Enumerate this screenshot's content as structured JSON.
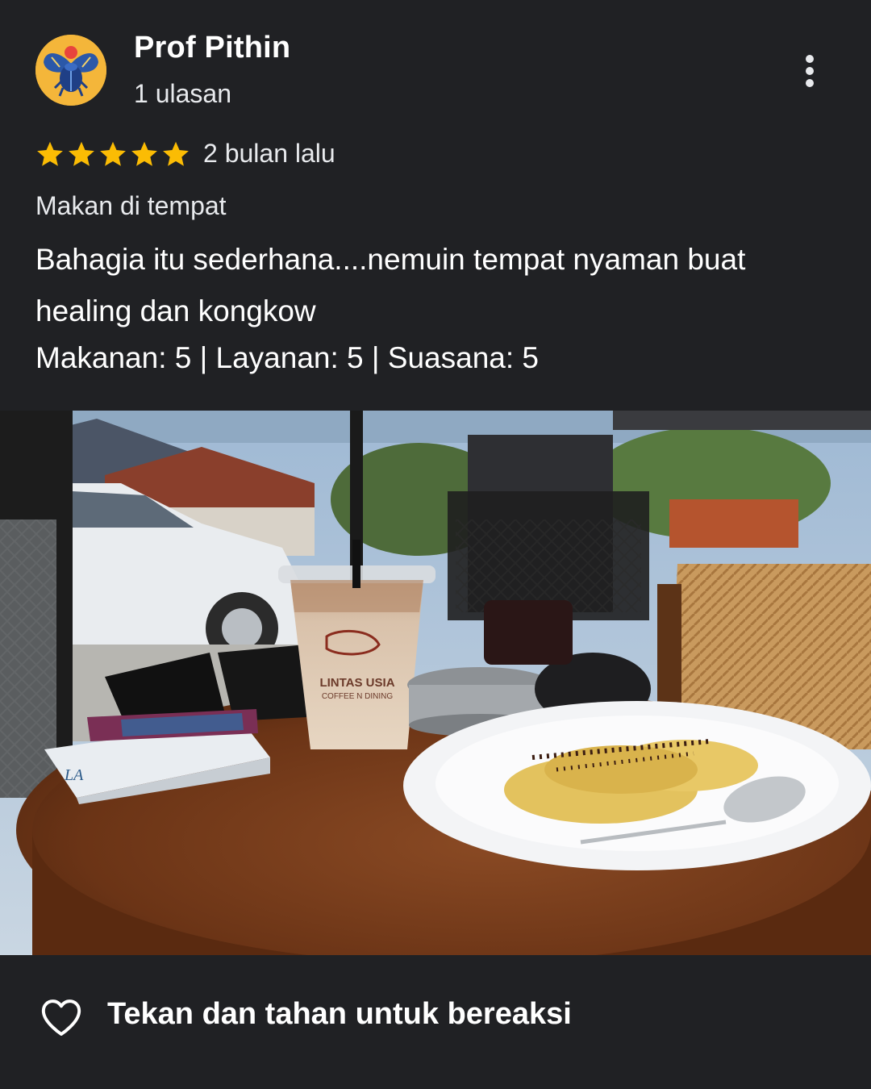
{
  "review": {
    "user_name": "Prof Pithin",
    "review_count": "1 ulasan",
    "avatar_icon": "scarab-beetle-avatar",
    "rating": 5,
    "max_rating": 5,
    "time": "2 bulan lalu",
    "dining_mode": "Makan di tempat",
    "text": "Bahagia itu sederhana....nemuin tempat nyaman buat healing dan kongkow",
    "sub_ratings": "Makanan: 5 | Layanan: 5 | Suasana: 5"
  },
  "photo": {
    "cup_brand": "LINTAS USIA",
    "cup_subtitle": "COFFEE N DINING",
    "pack_brand": "LA"
  },
  "reaction": {
    "label": "Tekan dan tahan untuk bereaksi",
    "icon": "heart-outline-icon"
  },
  "colors": {
    "background": "#202124",
    "star": "#fbbc04",
    "avatar_bg": "#f4b63a"
  }
}
